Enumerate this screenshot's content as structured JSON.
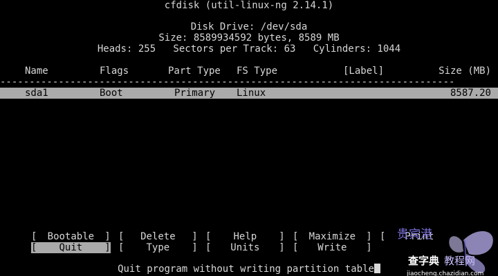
{
  "header": {
    "title": "cfdisk (util-linux-ng 2.14.1)",
    "disk_drive": "Disk Drive: /dev/sda",
    "size_line": "Size: 8589934592 bytes, 8589 MB",
    "geometry_line": "Heads: 255   Sectors per Track: 63   Cylinders: 1044"
  },
  "table": {
    "columns": {
      "name": "Name",
      "flags": "Flags",
      "part_type": "Part Type",
      "fs_type": "FS Type",
      "label": "[Label]",
      "size": "Size (MB)"
    },
    "separator": "------------------------------------------------------------------------------",
    "rows": [
      {
        "name": "sda1",
        "flags": "Boot",
        "part_type": "Primary",
        "fs_type": "Linux",
        "label": "",
        "size": "8587.20"
      }
    ]
  },
  "menu": {
    "row1": [
      {
        "label": "Bootable"
      },
      {
        "label": "Delete"
      },
      {
        "label": "Help"
      },
      {
        "label": "Maximize"
      },
      {
        "label": "Print"
      }
    ],
    "row2": [
      {
        "label": "Quit",
        "selected": true
      },
      {
        "label": "Type"
      },
      {
        "label": "Units"
      },
      {
        "label": "Write"
      }
    ]
  },
  "status": {
    "message": "Quit program without writing partition table"
  },
  "watermark": {
    "line1": "贵宾港",
    "line2": "查字典",
    "line3": "教程网",
    "line4": "jiaocheng.chazidian.com"
  },
  "colors": {
    "background": "#000000",
    "text": "#d8d8d8",
    "highlight_bg": "#aaaaaa",
    "highlight_fg": "#000000"
  }
}
